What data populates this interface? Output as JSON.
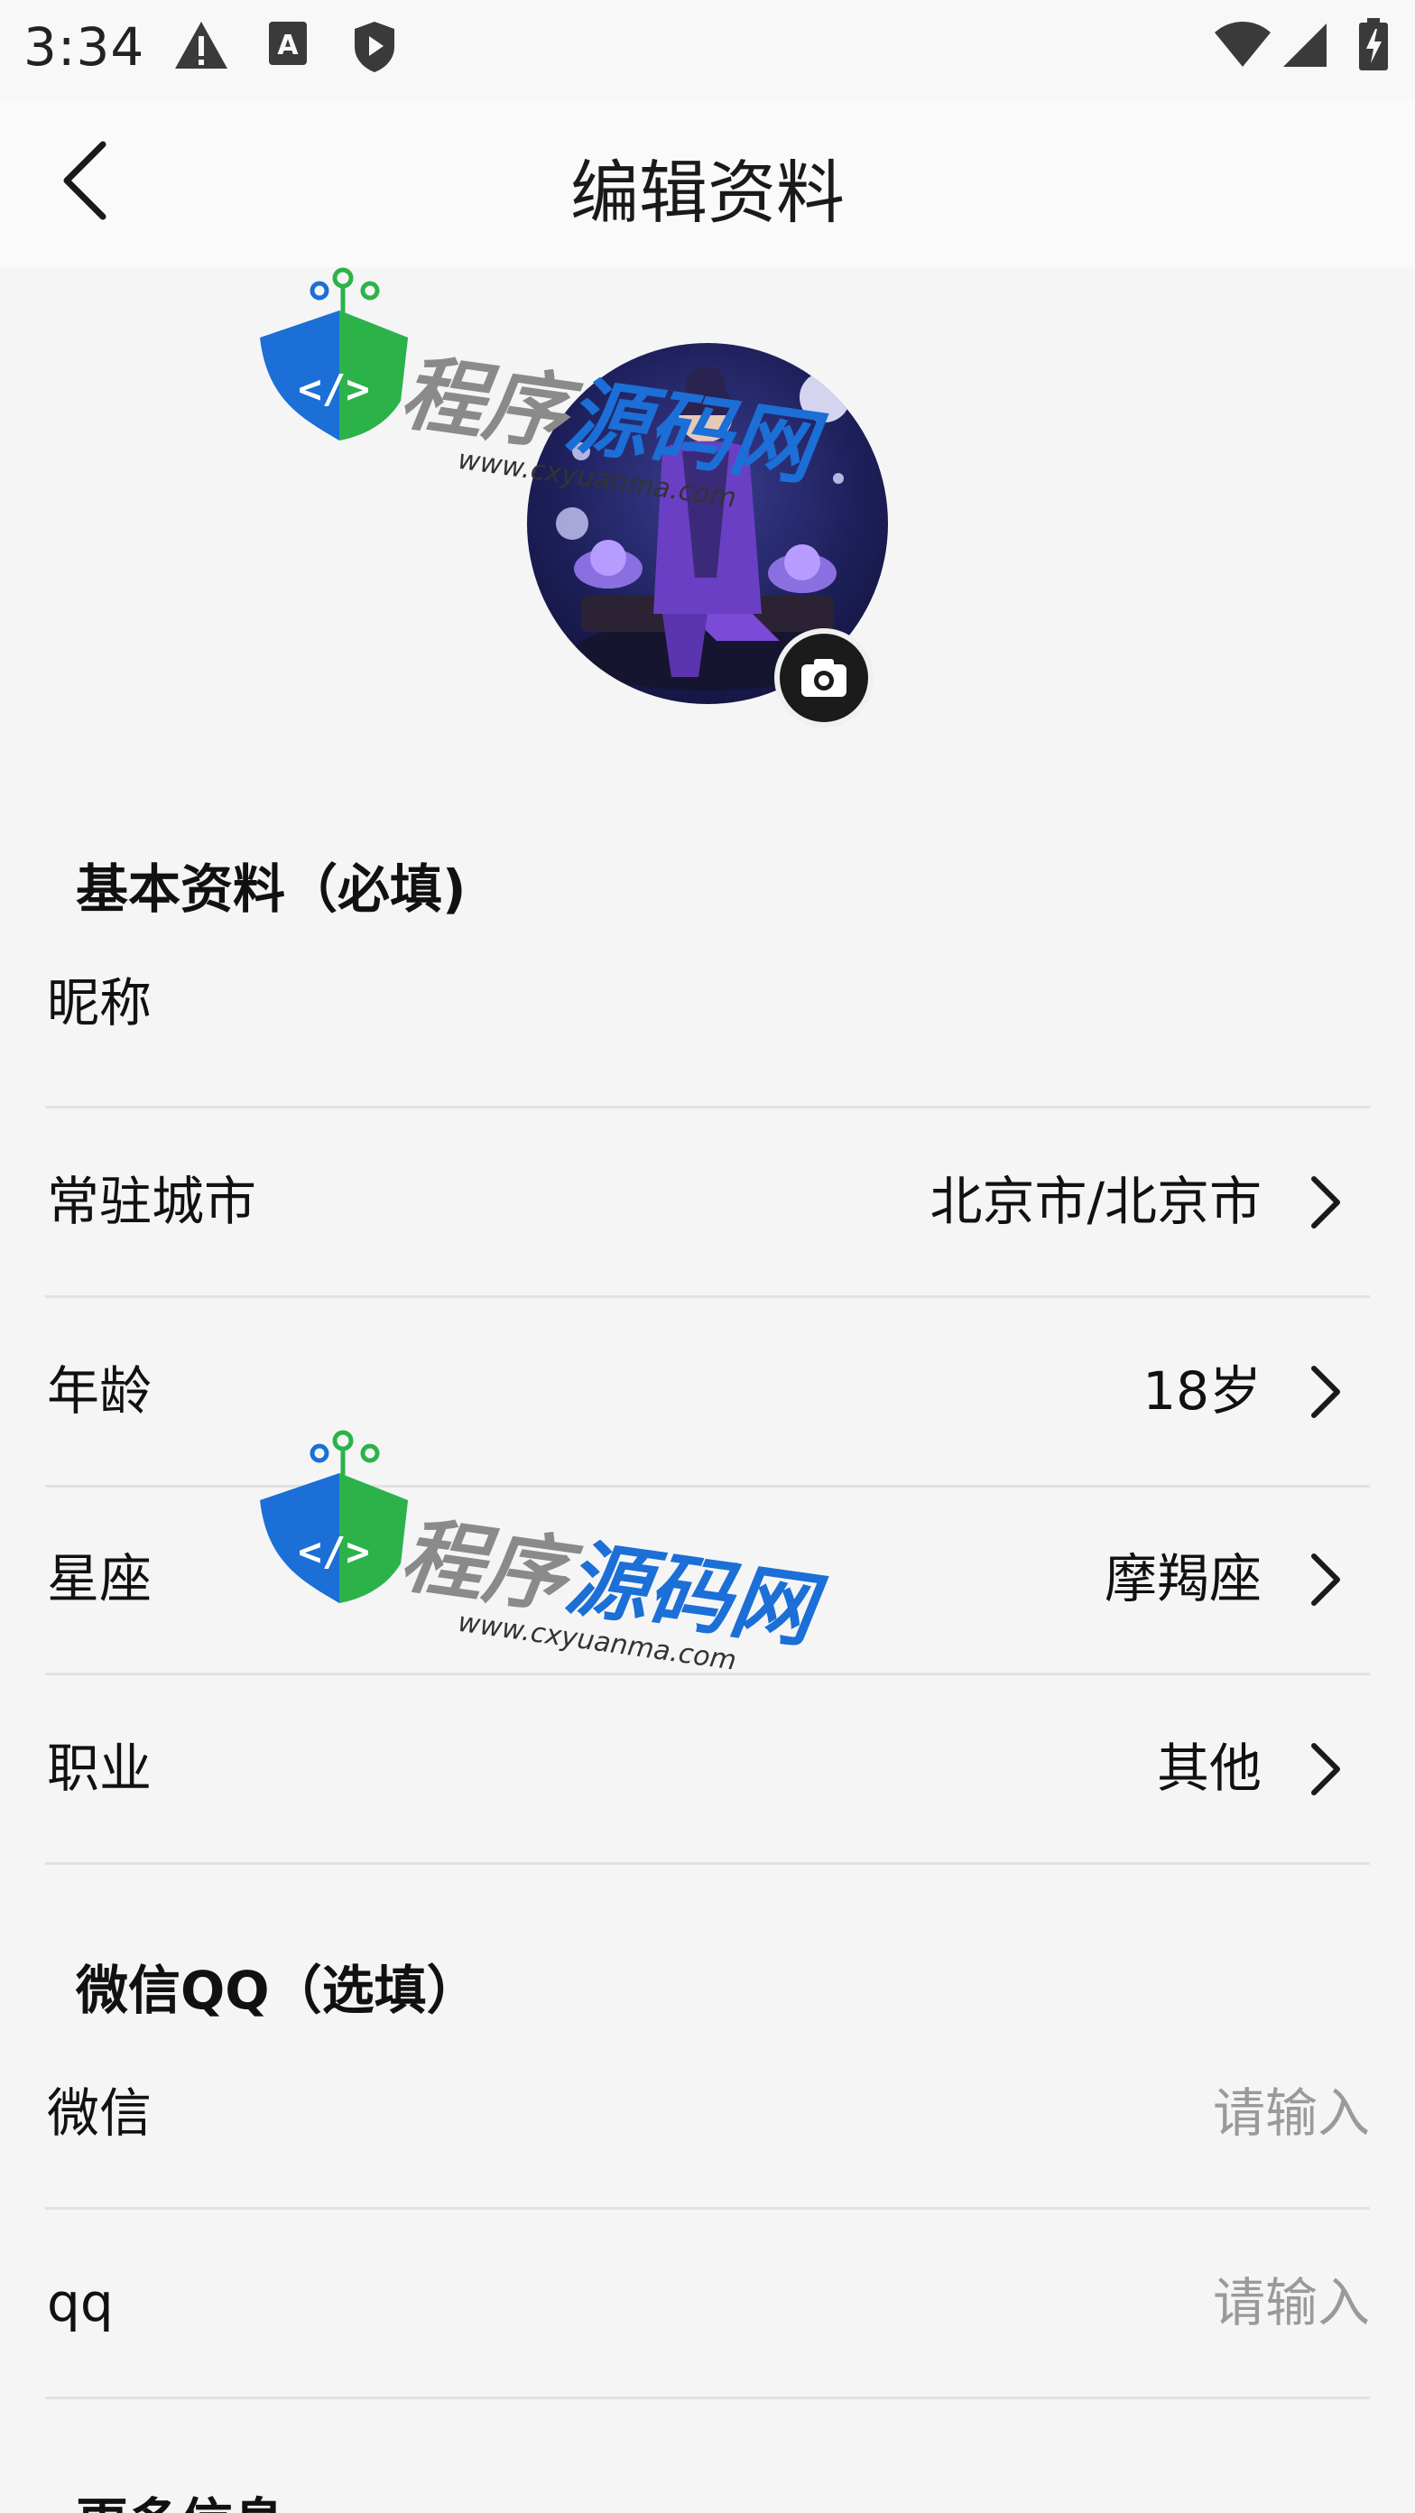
{
  "status_bar": {
    "time": "3:34",
    "icons": [
      "warning-icon",
      "a-box-icon",
      "shield-play-icon",
      "wifi-icon",
      "cellular-signal-icon",
      "battery-charging-icon"
    ]
  },
  "header": {
    "title": "编辑资料",
    "back_icon": "chevron-left-icon"
  },
  "avatar": {
    "edit_icon": "camera-icon"
  },
  "sections": {
    "basic": {
      "title": "基本资料（必填)",
      "nickname_label": "昵称",
      "city_label": "常驻城市",
      "city_value": "北京市/北京市",
      "age_label": "年龄",
      "age_value": "18岁",
      "zodiac_label": "星座",
      "zodiac_value": "摩羯座",
      "job_label": "职业",
      "job_value": "其他"
    },
    "contact": {
      "title": "微信QQ（选填）",
      "wechat_label": "微信",
      "wechat_placeholder": "请输入",
      "qq_label": "qq",
      "qq_placeholder": "请输入"
    },
    "more": {
      "title": "更多信息"
    }
  },
  "watermark": {
    "cn_gray": "程序",
    "cn_blue": "源码网",
    "url": "www.cxyuanma.com"
  },
  "colors": {
    "background": "#f5f5f5",
    "divider": "#e2e2e2",
    "placeholder": "#9a9a9a",
    "watermark_blue": "#1b6fd6",
    "watermark_green": "#2bb34a"
  }
}
